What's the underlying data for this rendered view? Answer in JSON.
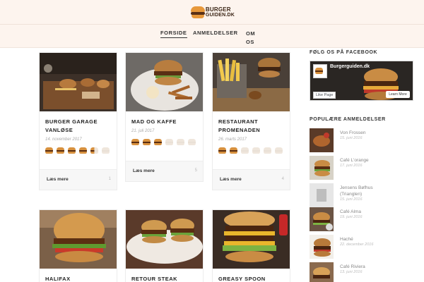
{
  "site": {
    "logo_line1": "BURGER",
    "logo_line2": "GUIDEN.DK",
    "accent": "#d8913e"
  },
  "nav": {
    "items": [
      {
        "label": "FORSIDE",
        "active": true
      },
      {
        "label": "ANMELDELSER",
        "active": false
      },
      {
        "label": "OM",
        "label2": "OS",
        "active": false
      }
    ]
  },
  "cards": [
    {
      "title_line1": "BURGER GARAGE",
      "title_line2": "VANLØSE",
      "date": "14. november 2017",
      "rating": 4.5,
      "read_more": "Læs mere",
      "comments": "1"
    },
    {
      "title_line1": "MAD OG KAFFE",
      "title_line2": "",
      "date": "21. juli 2017",
      "rating": 3,
      "read_more": "Læs mere",
      "comments": "5"
    },
    {
      "title_line1": "RESTAURANT",
      "title_line2": "PROMENADEN",
      "date": "26. marts 2017",
      "rating": 2,
      "read_more": "Læs mere",
      "comments": "4"
    },
    {
      "title_line1": "HALIFAX",
      "title_line2": ""
    },
    {
      "title_line1": "RETOUR STEAK",
      "title_line2": ""
    },
    {
      "title_line1": "GREASY SPOON",
      "title_line2": ""
    }
  ],
  "sidebar": {
    "facebook_heading": "FØLG OS PÅ FACEBOOK",
    "fb_page_name": "Burgerguiden.dk",
    "fb_like": "Like Page",
    "fb_learn": "Learn More",
    "popular_heading": "POPULÆRE ANMELDELSER",
    "popular": [
      {
        "title": "Von Frossen",
        "date": "15. juni 2016"
      },
      {
        "title": "Café L'orange",
        "date": "17. juni 2016"
      },
      {
        "title": "Jensens Bøfhus",
        "title2": "(Trianglen)",
        "date": "15. juni 2016"
      },
      {
        "title": "Café Alma",
        "date": "19. juni 2016"
      },
      {
        "title": "Haché",
        "date": "22. december 2016"
      },
      {
        "title": "Café Riviera",
        "date": "13. juni 2016"
      }
    ]
  }
}
